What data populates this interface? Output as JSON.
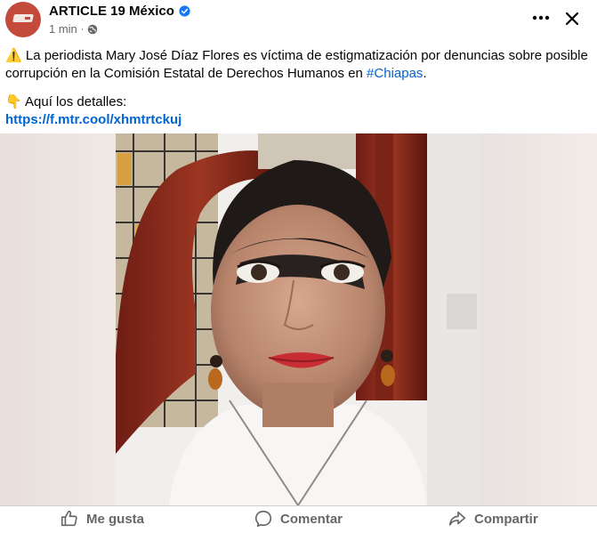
{
  "post": {
    "page_name": "ARTICLE 19 México",
    "timestamp": "1 min",
    "separator": "·",
    "text_icon": "⚠️",
    "text_main": " La periodista Mary José Díaz Flores  es víctima de estigmatización por denuncias sobre posible corrupción en la Comisión Estatal de Derechos Humanos en ",
    "hashtag": "#Chiapas",
    "text_end": ".",
    "details_icon": "👇",
    "details_text": " Aquí los detalles:",
    "link": "https://f.mtr.cool/xhmtrtckuj"
  },
  "icons": {
    "avatar": "article19-logo",
    "verified": "verified-badge-icon",
    "privacy": "globe-icon",
    "more": "more-options-icon",
    "close": "close-icon",
    "like": "thumbs-up-icon",
    "comment": "comment-bubble-icon",
    "share": "share-arrow-icon"
  },
  "actions": {
    "like_label": "Me gusta",
    "comment_label": "Comentar",
    "share_label": "Compartir"
  },
  "colors": {
    "brand_avatar": "#c44a3c",
    "link": "#0064d1",
    "verified": "#1877f2",
    "secondary_text": "#65676b"
  }
}
